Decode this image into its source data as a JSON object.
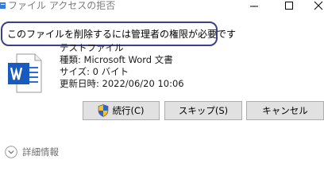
{
  "window": {
    "title": "ファイル アクセスの拒否",
    "icon": "folder-icon"
  },
  "message": "このファイルを削除するには管理者の権限が必要です",
  "file": {
    "icon": "word-document-icon",
    "name": "テストファイル",
    "type": "種類: Microsoft Word 文書",
    "size": "サイズ: 0 バイト",
    "modified": "更新日時: 2022/06/20 10:06"
  },
  "buttons": {
    "continue": "続行(C)",
    "skip": "スキップ(S)",
    "cancel": "キャンセル"
  },
  "details": {
    "label": "詳細情報"
  },
  "colors": {
    "highlight_border": "#3b3f8f",
    "word_blue": "#185abd",
    "button_bg": "#e1e1e1"
  }
}
